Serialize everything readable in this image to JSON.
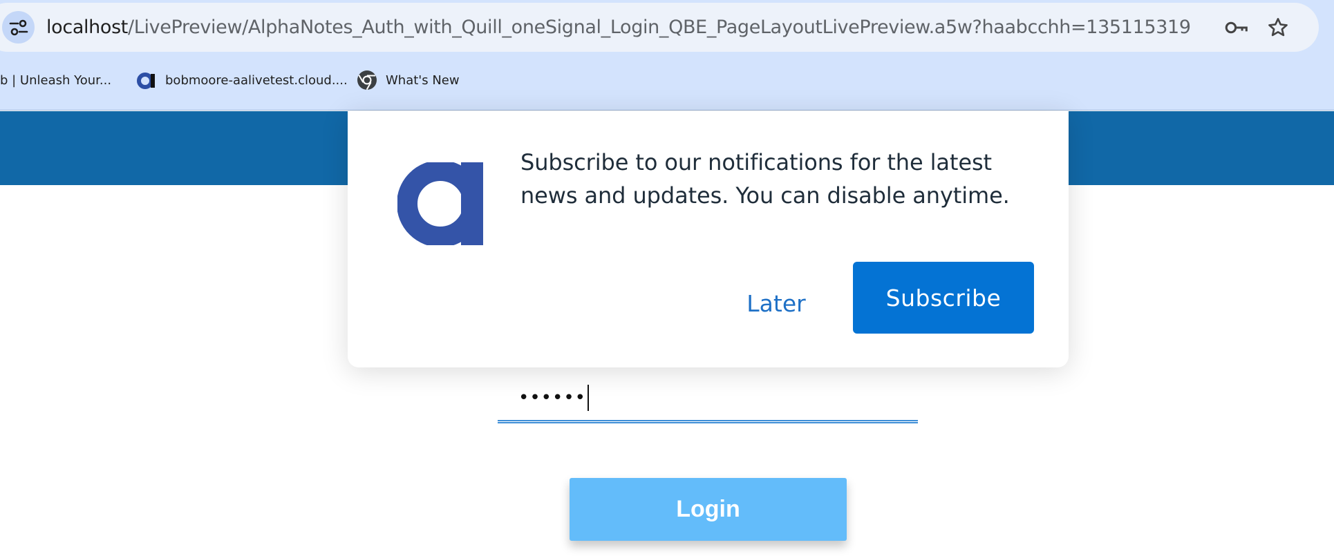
{
  "browser": {
    "url_host": "localhost",
    "url_path": "/LivePreview/AlphaNotes_Auth_with_Quill_oneSignal_Login_QBE_PageLayoutLivePreview.a5w?haabcchh=135115319",
    "icons": [
      "site-info-icon",
      "key-icon",
      "star-icon"
    ],
    "bookmarks": [
      {
        "label": "b | Unleash Your...",
        "icon": ""
      },
      {
        "label": "bobmoore-aalivetest.cloud....",
        "icon": "alpha-logo-icon"
      },
      {
        "label": "What's New",
        "icon": "chrome-icon"
      }
    ]
  },
  "page": {
    "banner_color": "#1168a7",
    "password_value": "••••••",
    "login_label": "Login",
    "login_color": "#63bcfa"
  },
  "popup": {
    "message": "Subscribe to our notifications for the latest news and updates. You can disable anytime.",
    "later_label": "Later",
    "subscribe_label": "Subscribe",
    "logo_color": "#3454a8",
    "accent_color": "#0473d4"
  }
}
